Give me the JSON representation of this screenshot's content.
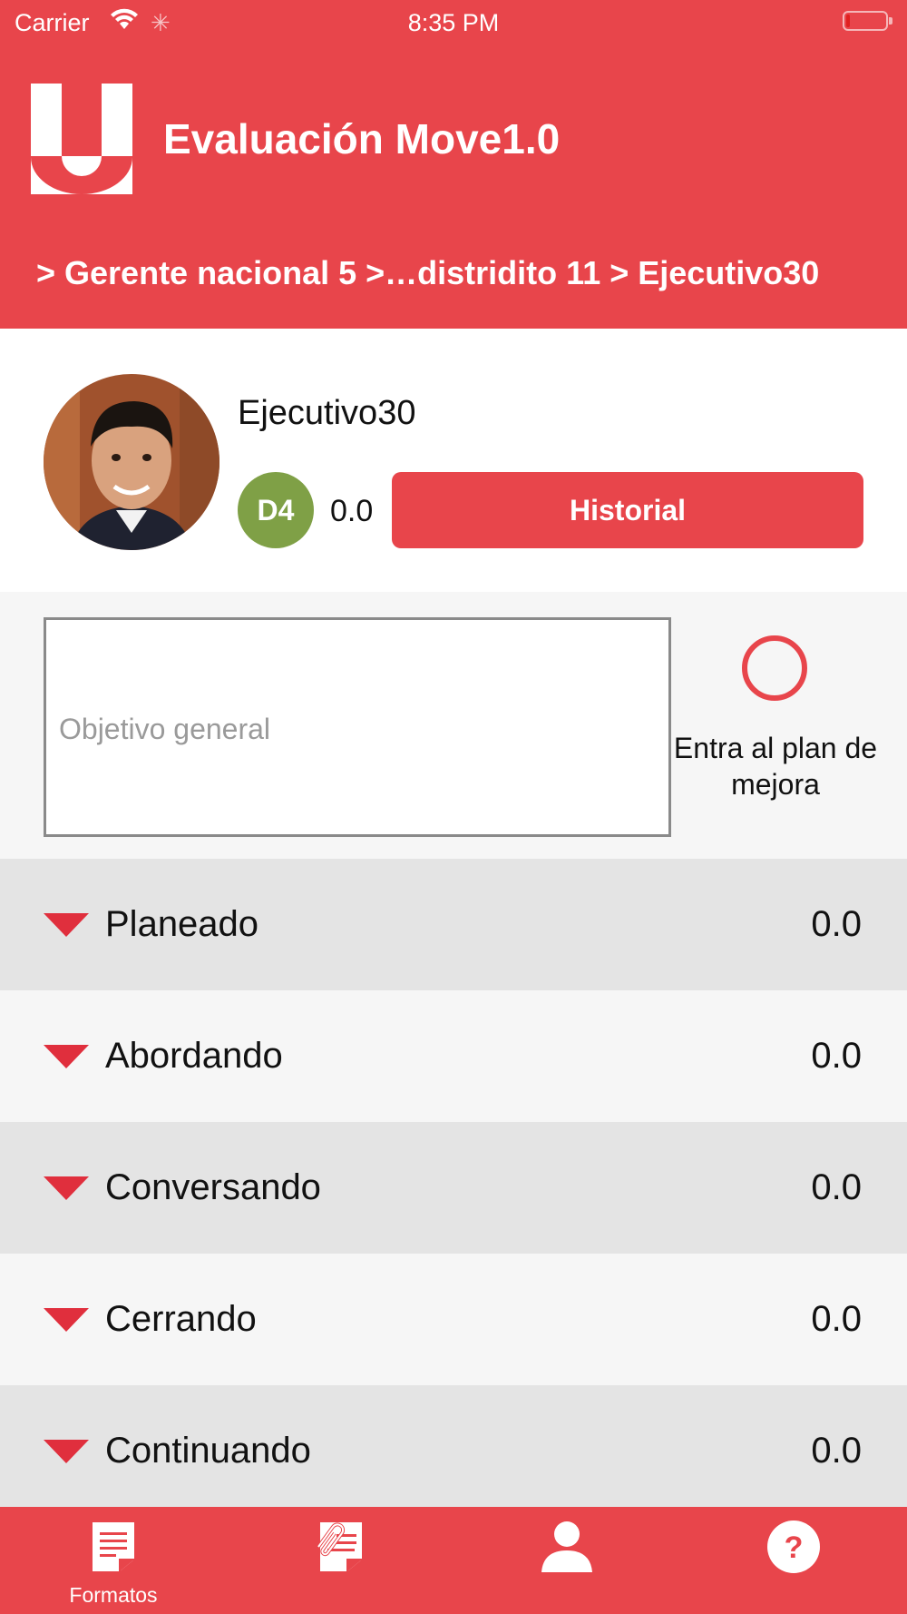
{
  "status_bar": {
    "carrier": "Carrier",
    "time": "8:35 PM",
    "icons": [
      "wifi-icon",
      "activity-spinner-icon",
      "battery-icon"
    ]
  },
  "header": {
    "title": "Evaluación Move1.0",
    "breadcrumb": "> Gerente nacional 5 >…distridito 11 > Ejecutivo30",
    "logo_icon": "u-logo-icon"
  },
  "profile": {
    "name": "Ejecutivo30",
    "level_badge": "D4",
    "level_color": "#7fa046",
    "score": "0.0",
    "historial_label": "Historial"
  },
  "objective": {
    "placeholder": "Objetivo general",
    "value": "",
    "plan_label": "Entra al plan de mejora",
    "plan_checked": false
  },
  "sections": [
    {
      "label": "Planeado",
      "value": "0.0"
    },
    {
      "label": "Abordando",
      "value": "0.0"
    },
    {
      "label": "Conversando",
      "value": "0.0"
    },
    {
      "label": "Cerrando",
      "value": "0.0"
    },
    {
      "label": "Continuando",
      "value": "0.0"
    }
  ],
  "tabbar": {
    "tabs": [
      {
        "label": "Formatos",
        "icon": "document-icon"
      },
      {
        "label": "",
        "icon": "attached-document-icon"
      },
      {
        "label": "",
        "icon": "person-icon"
      },
      {
        "label": "",
        "icon": "help-icon"
      }
    ]
  },
  "colors": {
    "brand_red": "#e8454b",
    "row_dark": "#e4e4e4",
    "row_light": "#f6f6f6"
  }
}
